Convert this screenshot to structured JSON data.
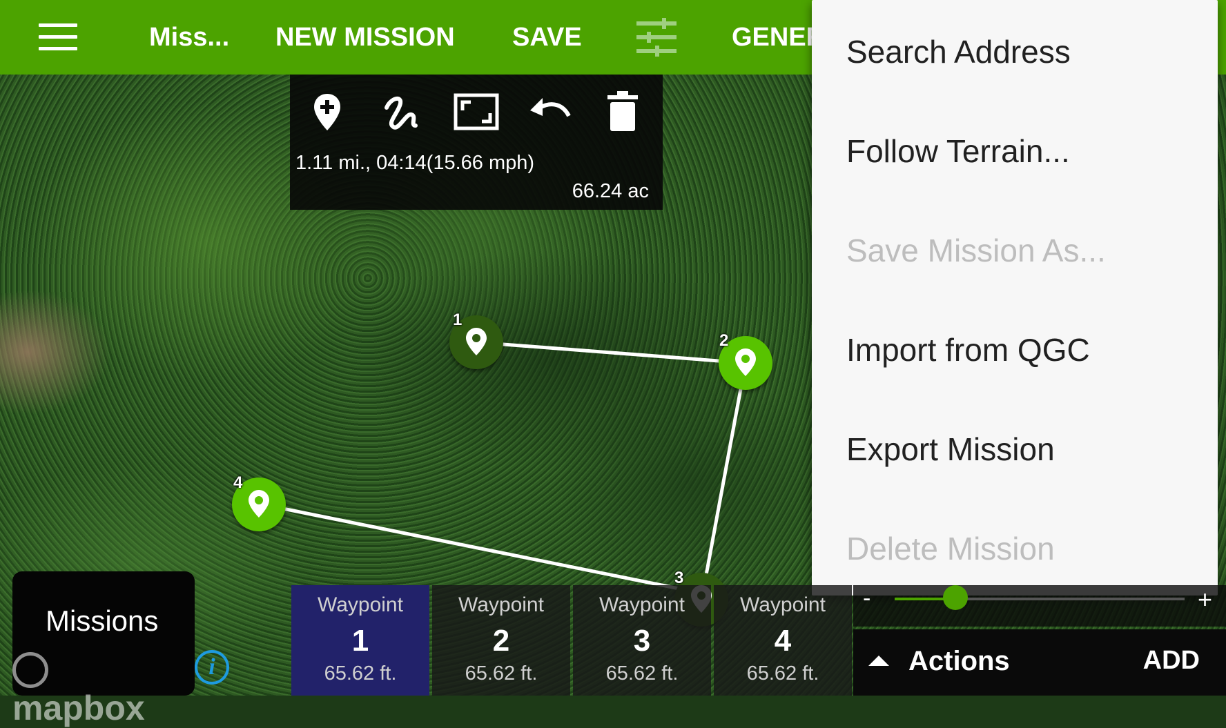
{
  "topbar": {
    "title": "Miss...",
    "new_mission": "NEW MISSION",
    "save": "SAVE",
    "general_partial": "GENER",
    "background_color": "#4ca300"
  },
  "tool_panel": {
    "tools": [
      "add-waypoint-icon",
      "draw-path-icon",
      "fit-bounds-icon",
      "undo-icon",
      "delete-icon"
    ],
    "stats": "1.11 mi., 04:14(15.66 mph)",
    "area": "66.24 ac"
  },
  "overflow_menu": {
    "items": [
      {
        "label": "Search Address",
        "enabled": true
      },
      {
        "label": "Follow Terrain...",
        "enabled": true
      },
      {
        "label": "Save Mission As...",
        "enabled": false
      },
      {
        "label": "Import from QGC",
        "enabled": true
      },
      {
        "label": "Export Mission",
        "enabled": true
      },
      {
        "label": "Delete Mission",
        "enabled": false
      }
    ]
  },
  "map": {
    "markers": [
      {
        "number": "1",
        "color": "#2f5a10",
        "icon": "location-pin-icon"
      },
      {
        "number": "2",
        "color": "#58c300",
        "icon": "location-pin-icon"
      },
      {
        "number": "3",
        "color": "#2f5a10",
        "icon": "location-pin-icon"
      },
      {
        "number": "4",
        "color": "#58c300",
        "icon": "location-pin-icon"
      }
    ],
    "attribution": "mapbox",
    "info_glyph": "i"
  },
  "bottom": {
    "missions_label": "Missions",
    "waypoints": [
      {
        "title": "Waypoint",
        "number": "1",
        "altitude": "65.62 ft.",
        "selected": true
      },
      {
        "title": "Waypoint",
        "number": "2",
        "altitude": "65.62 ft.",
        "selected": false
      },
      {
        "title": "Waypoint",
        "number": "3",
        "altitude": "65.62 ft.",
        "selected": false
      },
      {
        "title": "Waypoint",
        "number": "4",
        "altitude": "65.62 ft.",
        "selected": false
      }
    ],
    "slider": {
      "minus": "-",
      "plus": "+",
      "value_fraction": 0.21
    },
    "actions_label": "Actions",
    "add_label": "ADD"
  },
  "colors": {
    "accent": "#4ca300",
    "selected_card": "#22226a",
    "info_blue": "#1e9be0"
  }
}
